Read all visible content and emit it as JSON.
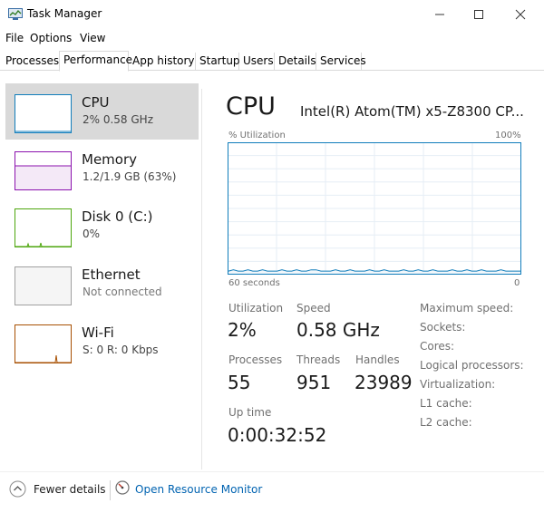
{
  "window": {
    "title": "Task Manager"
  },
  "menu": {
    "file": "File",
    "options": "Options",
    "view": "View"
  },
  "tabs": [
    "Processes",
    "Performance",
    "App history",
    "Startup",
    "Users",
    "Details",
    "Services"
  ],
  "sidebar": {
    "items": [
      {
        "name": "CPU",
        "sub": "2%  0.58 GHz"
      },
      {
        "name": "Memory",
        "sub": "1.2/1.9 GB (63%)"
      },
      {
        "name": "Disk 0 (C:)",
        "sub": "0%"
      },
      {
        "name": "Ethernet",
        "sub": "Not connected"
      },
      {
        "name": "Wi-Fi",
        "sub": "S: 0  R: 0 Kbps"
      }
    ]
  },
  "main": {
    "title": "CPU",
    "model": "Intel(R) Atom(TM) x5-Z8300 CP...",
    "graph": {
      "y_label": "% Utilization",
      "y_max_label": "100%",
      "x_label": "60 seconds",
      "x_min_label": "0",
      "history": [
        2,
        3,
        2,
        2,
        3,
        2,
        2,
        3,
        2,
        2,
        2,
        3,
        2,
        2,
        3,
        2,
        2,
        3,
        3,
        2,
        2,
        2,
        3,
        2,
        2,
        3,
        2,
        2,
        2,
        3,
        2,
        2,
        3,
        2,
        2,
        2,
        3,
        2,
        2,
        3,
        2,
        2,
        3,
        2,
        2,
        2,
        3,
        2,
        2,
        3,
        2,
        2,
        3,
        2,
        2,
        2,
        3,
        2,
        2,
        2,
        2
      ]
    },
    "stats": {
      "utilization_label": "Utilization",
      "utilization_value": "2%",
      "speed_label": "Speed",
      "speed_value": "0.58 GHz",
      "processes_label": "Processes",
      "processes_value": "55",
      "threads_label": "Threads",
      "threads_value": "951",
      "handles_label": "Handles",
      "handles_value": "23989",
      "uptime_label": "Up time",
      "uptime_value": "0:00:32:52"
    },
    "specs": [
      "Maximum speed:",
      "Sockets:",
      "Cores:",
      "Logical processors:",
      "Virtualization:",
      "L1 cache:",
      "L2 cache:"
    ]
  },
  "footer": {
    "fewer_details": "Fewer details",
    "resource_monitor": "Open Resource Monitor"
  },
  "colors": {
    "cpu_line": "#117dbb",
    "cpu_fill": "#f1f6fa",
    "memory": "#8b12ae",
    "disk": "#4da60c",
    "wifi": "#a74f01",
    "ethernet": "#a0a0a0",
    "selected": "#d9d9d9",
    "link": "#0063b1"
  }
}
